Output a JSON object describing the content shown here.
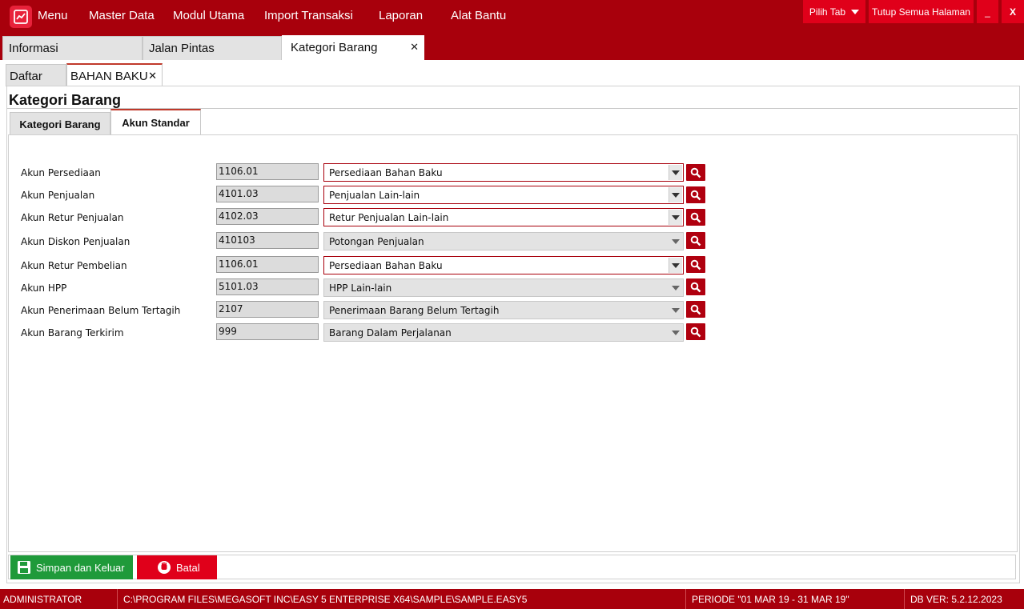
{
  "menu": {
    "items": [
      {
        "label": "Menu"
      },
      {
        "label": "Master Data"
      },
      {
        "label": "Modul Utama"
      },
      {
        "label": "Import Transaksi"
      },
      {
        "label": "Laporan"
      },
      {
        "label": "Alat Bantu"
      }
    ]
  },
  "window": {
    "pick_tab": "Pilih Tab",
    "close_all": "Tutup Semua Halaman",
    "minimize": "_",
    "close": "X"
  },
  "main_tabs": [
    {
      "label": "Informasi"
    },
    {
      "label": "Jalan Pintas"
    },
    {
      "label": "Kategori Barang",
      "active": true
    }
  ],
  "sub_tabs": [
    {
      "label": "Daftar"
    },
    {
      "label": "BAHAN BAKU",
      "active": true
    }
  ],
  "page_title": "Kategori Barang",
  "inner_tabs": [
    {
      "label": "Kategori Barang"
    },
    {
      "label": "Akun Standar",
      "active": true
    }
  ],
  "fields": [
    {
      "label": "Akun Persediaan",
      "code": "1106.01",
      "account": "Persediaan Bahan Baku",
      "enabled": true
    },
    {
      "label": "Akun Penjualan",
      "code": "4101.03",
      "account": "Penjualan Lain-lain",
      "enabled": true
    },
    {
      "label": "Akun Retur Penjualan",
      "code": "4102.03",
      "account": "Retur Penjualan Lain-lain",
      "enabled": true
    },
    {
      "label": "Akun Diskon Penjualan",
      "code": "410103",
      "account": "Potongan Penjualan",
      "enabled": false
    },
    {
      "label": "Akun Retur Pembelian",
      "code": "1106.01",
      "account": "Persediaan Bahan Baku",
      "enabled": true
    },
    {
      "label": "Akun HPP",
      "code": "5101.03",
      "account": "HPP Lain-lain",
      "enabled": false
    },
    {
      "label": "Akun Penerimaan Belum Tertagih",
      "code": "2107",
      "account": "Penerimaan Barang Belum Tertagih",
      "enabled": false
    },
    {
      "label": "Akun Barang Terkirim",
      "code": "999",
      "account": "Barang Dalam Perjalanan",
      "enabled": false
    }
  ],
  "buttons": {
    "save": "Simpan dan Keluar",
    "cancel": "Batal"
  },
  "status": {
    "user": "ADMINISTRATOR",
    "path": "C:\\PROGRAM FILES\\MEGASOFT INC\\EASY 5 ENTERPRISE X64\\SAMPLE\\SAMPLE.EASY5",
    "period": "PERIODE \"01 MAR 19 - 31 MAR 19\"",
    "db_version": "DB VER: 5.2.12.2023"
  },
  "colors": {
    "brand": "#a8000c",
    "accent": "#e0001a",
    "save": "#1f9a3a"
  }
}
